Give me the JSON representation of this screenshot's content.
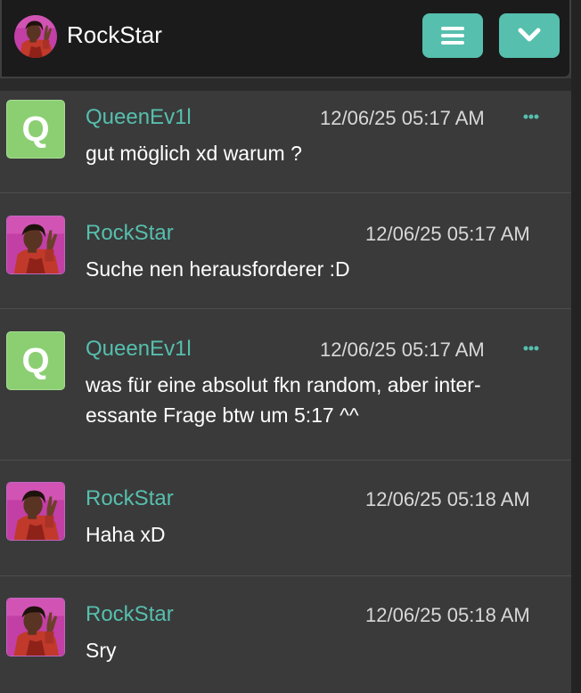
{
  "header": {
    "title": "RockStar",
    "avatar_icon": "user-avatar-icon",
    "menu_icon": "hamburger-menu-icon",
    "collapse_icon": "chevron-down-icon",
    "accent": "#56bfae"
  },
  "messages": [
    {
      "user": "QueenEv1l",
      "avatar_letter": "Q",
      "timestamp": "12/06/25 05:17 AM",
      "text_lines": [
        "gut möglich xd warum ?"
      ]
    },
    {
      "user": "RockStar",
      "timestamp": "12/06/25 05:17 AM",
      "text_lines": [
        "Suche nen herausforderer :D"
      ]
    },
    {
      "user": "QueenEv1l",
      "avatar_letter": "Q",
      "timestamp": "12/06/25 05:17 AM",
      "text_lines": [
        "was für eine absolut fkn random, aber inter-",
        "essante Frage btw um 5:17 ^^"
      ]
    },
    {
      "user": "RockStar",
      "timestamp": "12/06/25 05:18 AM",
      "text_lines": [
        "Haha xD"
      ]
    },
    {
      "user": "RockStar",
      "timestamp": "12/06/25 05:18 AM",
      "text_lines": [
        "Sry"
      ]
    }
  ]
}
